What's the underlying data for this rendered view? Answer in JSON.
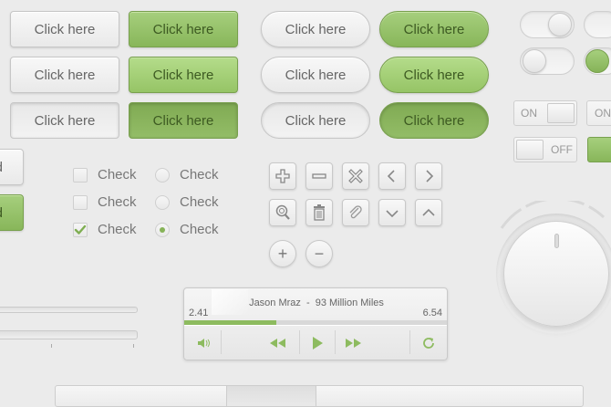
{
  "buttons": {
    "square_grey": [
      "Click here",
      "Click here",
      "Click here"
    ],
    "square_green": [
      "Click here",
      "Click here",
      "Click here"
    ],
    "pill_grey": [
      "Click here",
      "Click here",
      "Click here"
    ],
    "pill_green": [
      "Click here",
      "Click here",
      "Click here"
    ]
  },
  "partial_buttons": {
    "top": "d",
    "bottom": "d"
  },
  "checkboxes": [
    {
      "label": "Check",
      "checked": false
    },
    {
      "label": "Check",
      "checked": false
    },
    {
      "label": "Check",
      "checked": true
    }
  ],
  "radios": [
    {
      "label": "Check",
      "selected": false
    },
    {
      "label": "Check",
      "selected": false
    },
    {
      "label": "Check",
      "selected": true
    }
  ],
  "switches": {
    "on_label": "ON",
    "off_label": "OFF",
    "on_label_2": "ON"
  },
  "icon_buttons": [
    "plus-icon",
    "minus-icon",
    "close-icon",
    "chevron-left-icon",
    "chevron-right-icon",
    "search-icon",
    "trash-icon",
    "paperclip-icon",
    "chevron-down-icon",
    "chevron-up-icon"
  ],
  "circle_buttons": {
    "plus": "+",
    "minus": "−"
  },
  "player": {
    "artist": "Jason Mraz",
    "separator": "-",
    "title": "93 Million Miles",
    "elapsed": "2.41",
    "total": "6.54",
    "progress": 0.35
  },
  "colors": {
    "accent": "#8dbb5f",
    "accent_dark": "#6f9947",
    "text": "#777777",
    "background": "#ebebeb"
  }
}
